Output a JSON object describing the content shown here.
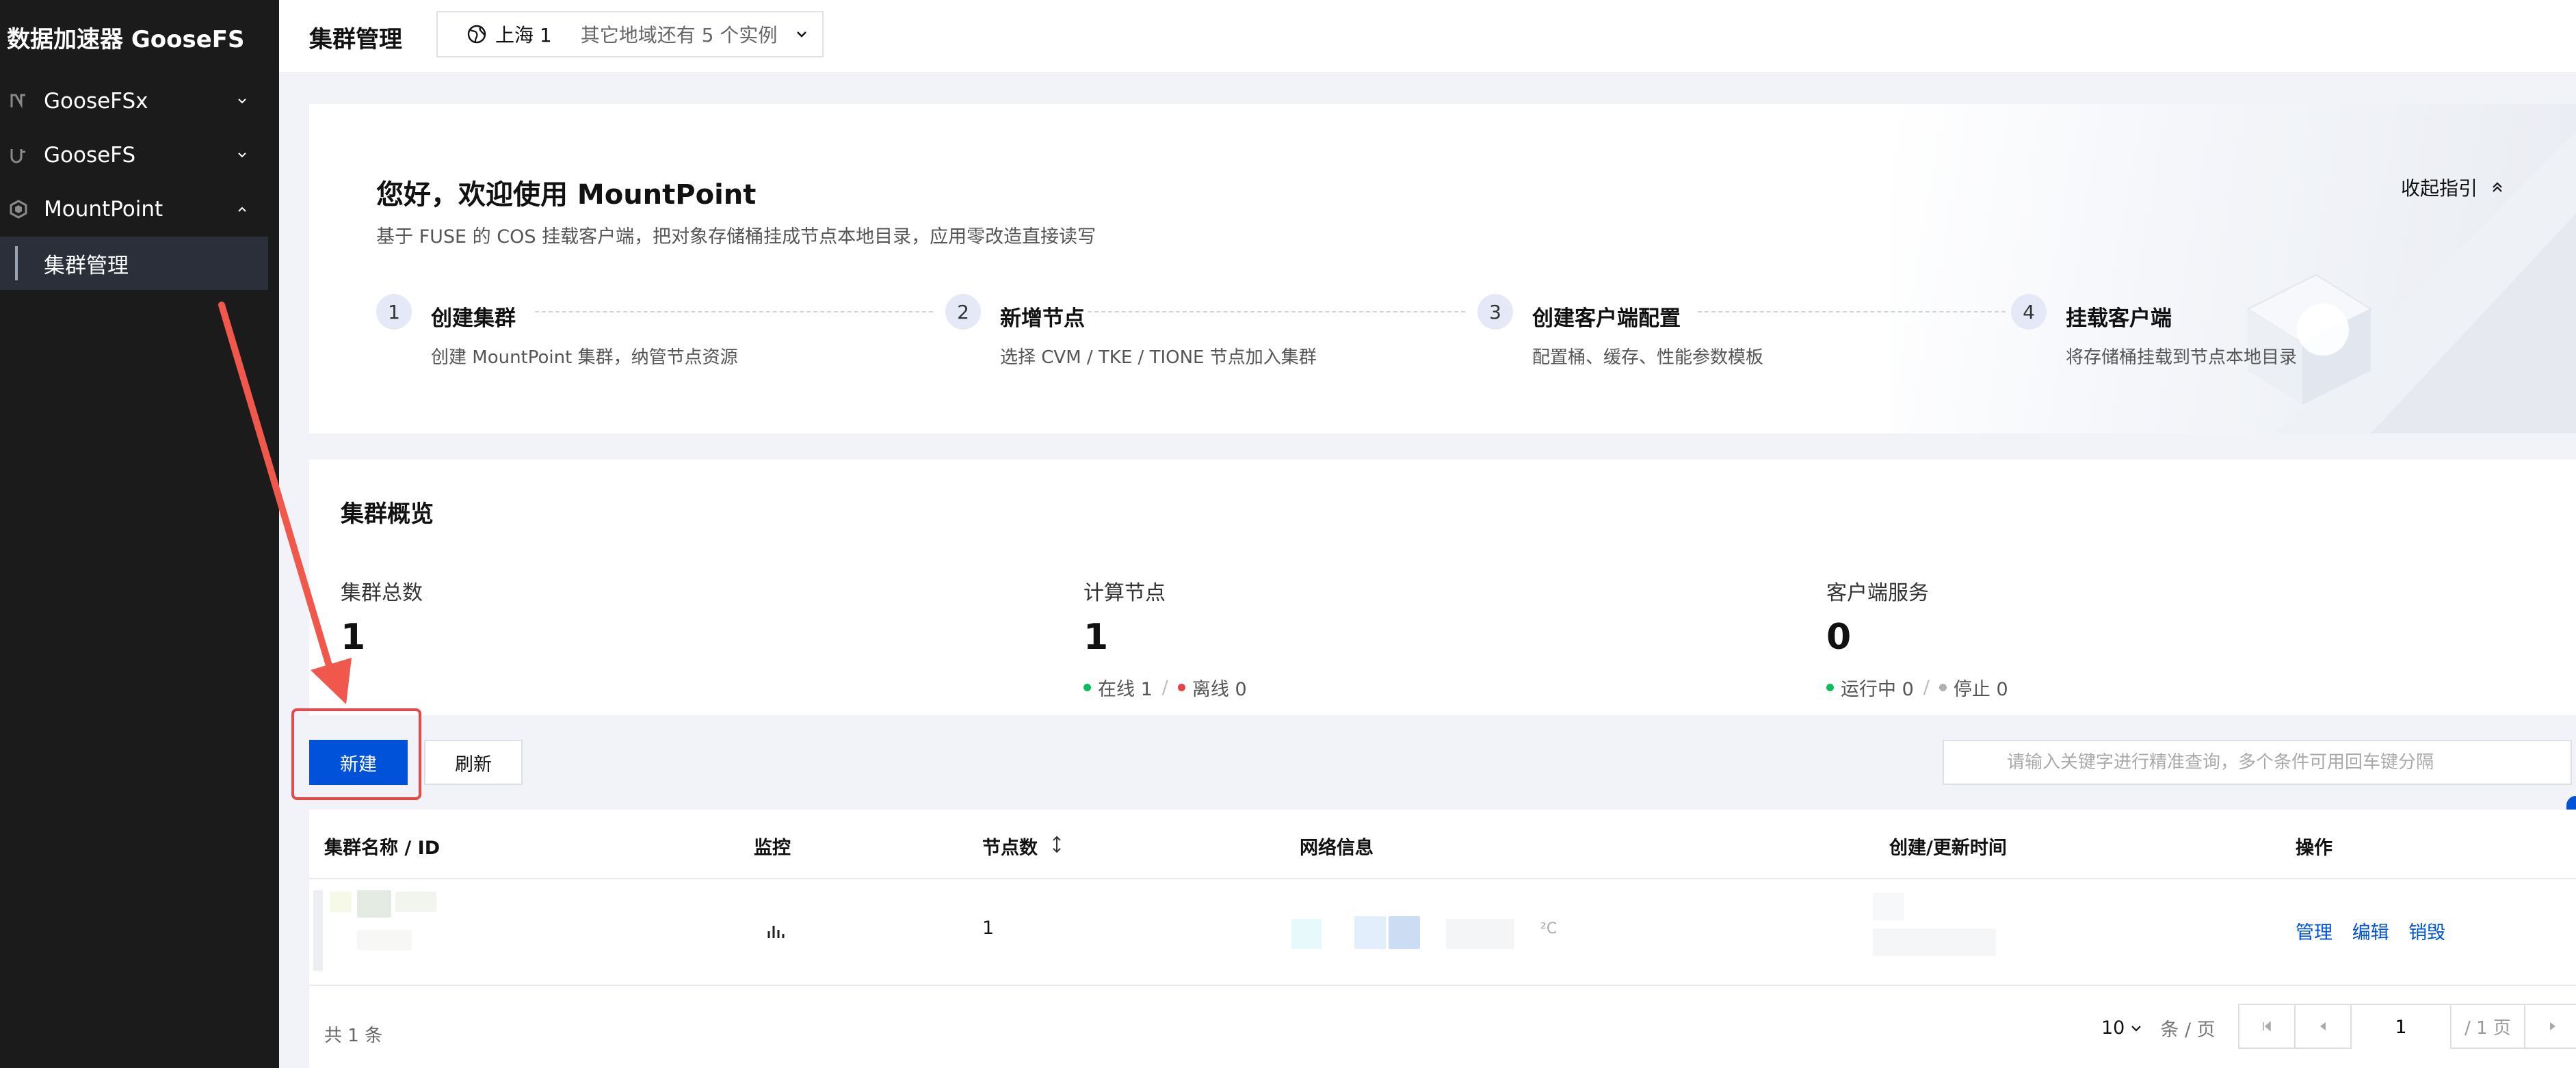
{
  "sidebar": {
    "title": "数据加速器 GooseFS",
    "items": [
      {
        "label": "GooseFSx",
        "icon": "goosefsx-icon"
      },
      {
        "label": "GooseFS",
        "icon": "goosefs-icon"
      },
      {
        "label": "MountPoint",
        "icon": "mountpoint-icon"
      }
    ],
    "sub_item": "集群管理"
  },
  "header": {
    "title": "集群管理",
    "region": "上海 1",
    "region_note": "其它地域还有 5 个实例"
  },
  "guide": {
    "title": "您好，欢迎使用 MountPoint",
    "subtitle": "基于 FUSE 的 COS 挂载客户端，把对象存储桶挂成节点本地目录，应用零改造直接读写",
    "collapse": "收起指引",
    "steps": [
      {
        "num": "1",
        "title": "创建集群",
        "desc": "创建 MountPoint 集群，纳管节点资源"
      },
      {
        "num": "2",
        "title": "新增节点",
        "desc": "选择 CVM / TKE / TIONE 节点加入集群"
      },
      {
        "num": "3",
        "title": "创建客户端配置",
        "desc": "配置桶、缓存、性能参数模板"
      },
      {
        "num": "4",
        "title": "挂载客户端",
        "desc": "将存储桶挂载到节点本地目录"
      }
    ]
  },
  "overview": {
    "title": "集群概览",
    "stats": [
      {
        "label": "集群总数",
        "value": "1"
      },
      {
        "label": "计算节点",
        "value": "1",
        "online": "在线 1",
        "offline": "离线 0"
      },
      {
        "label": "客户端服务",
        "value": "0",
        "running": "运行中 0",
        "stopped": "停止 0"
      }
    ]
  },
  "toolbar": {
    "create": "新建",
    "refresh": "刷新",
    "search_placeholder": "请输入关键字进行精准查询，多个条件可用回车键分隔"
  },
  "table": {
    "columns": [
      "集群名称 / ID",
      "监控",
      "节点数",
      "网络信息",
      "创建/更新时间",
      "操作"
    ],
    "row": {
      "nodes": "1",
      "network_suffix": "²C",
      "actions": [
        "管理",
        "编辑",
        "销毁"
      ]
    },
    "footer": {
      "total": "共 1 条",
      "page_size": "10",
      "per_page": "条 / 页",
      "page": "1",
      "total_pages": "/ 1 页"
    }
  },
  "colors": {
    "primary": "#0052d9",
    "sidebar_bg": "#1b1b1b",
    "highlight": "#e5494a",
    "online": "#0abf5b",
    "offline": "#e54545",
    "stopped": "#b0b0b0"
  }
}
